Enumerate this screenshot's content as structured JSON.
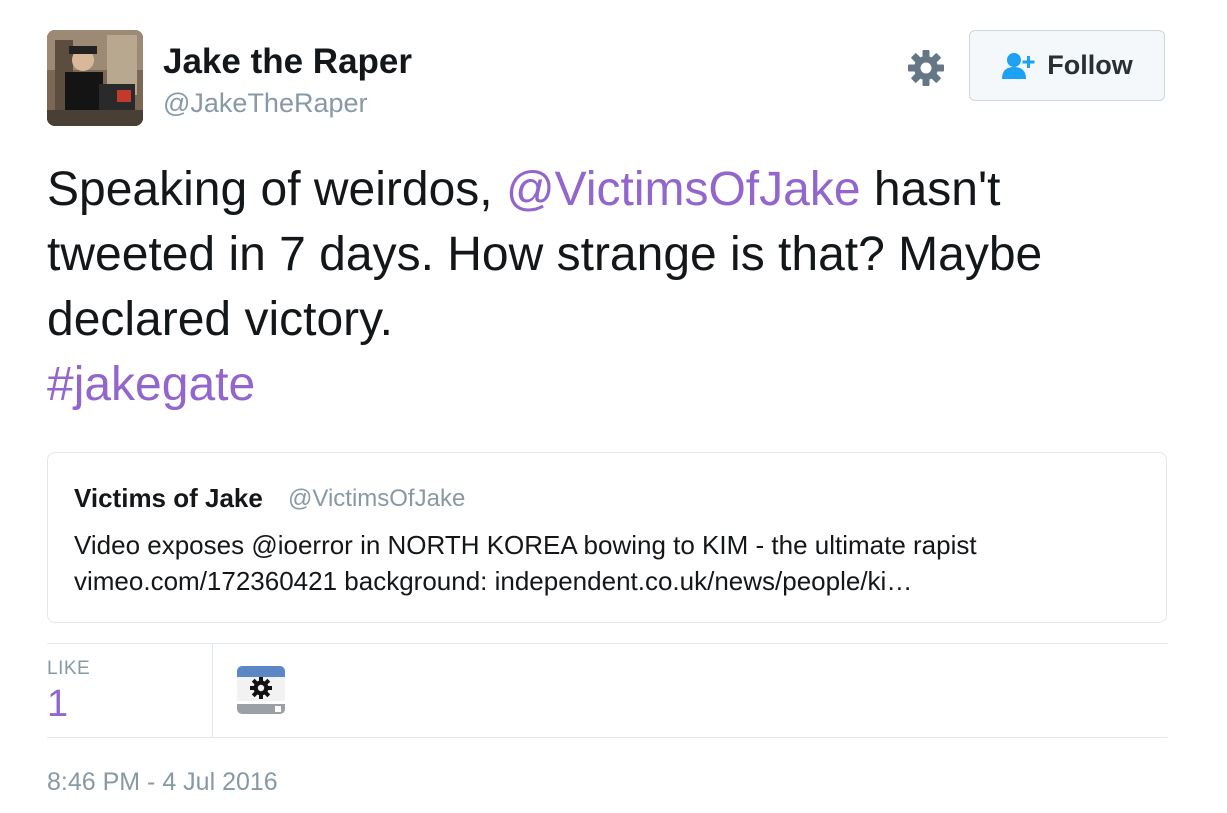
{
  "user": {
    "name": "Jake the Raper",
    "handle": "@JakeTheRaper"
  },
  "actions": {
    "follow_label": "Follow"
  },
  "tweet": {
    "lines": [
      {
        "before": "Speaking of weirdos, ",
        "mention": "@VictimsOfJake",
        "after": " hasn't"
      },
      {
        "text": "tweeted in 7 days. How strange is that? Maybe"
      },
      {
        "text": "declared victory."
      }
    ],
    "hashtag": "#jakegate"
  },
  "quoted": {
    "name": "Victims of Jake",
    "handle": "@VictimsOfJake",
    "line1": "Video exposes @ioerror in NORTH KOREA bowing to KIM - the ultimate rapist",
    "line2": "vimeo.com/172360421 background: independent.co.uk/news/people/ki…"
  },
  "stats": {
    "like_label": "LIKE",
    "like_count": "1"
  },
  "timestamp": "8:46 PM - 4 Jul 2016",
  "colors": {
    "link": "#9266cc",
    "muted": "#8899a6",
    "follow_icon": "#1da1f2",
    "gear": "#657786"
  },
  "icons": [
    "gear-icon",
    "follow-person-plus-icon"
  ]
}
